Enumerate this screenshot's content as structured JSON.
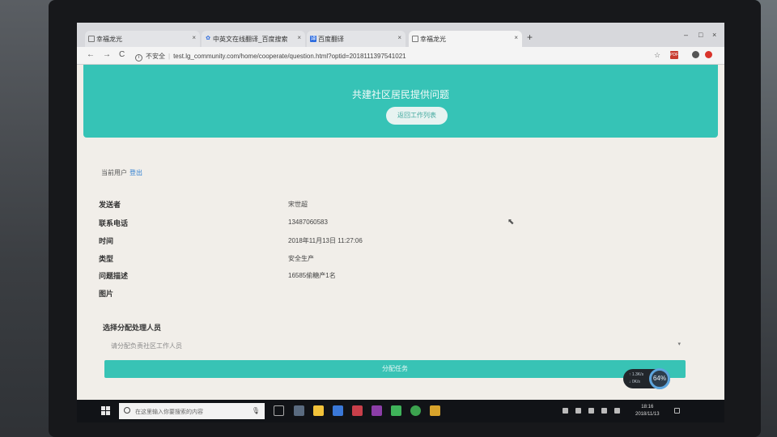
{
  "browser": {
    "tabs": [
      {
        "title": "幸福龙光",
        "close": "×"
      },
      {
        "title": "中英文在线翻译_百度搜索",
        "close": "×"
      },
      {
        "title": "百度翻译",
        "close": "×"
      },
      {
        "title": "幸福龙光",
        "close": "×"
      }
    ],
    "new_tab": "+",
    "window_controls": [
      "–",
      "□",
      "×"
    ],
    "nav": {
      "back": "←",
      "forward": "→",
      "reload": "C"
    },
    "address": {
      "security": "不安全",
      "url": "test.lg_community.com/home/cooperate/question.html?optid=20181113975410​21"
    }
  },
  "page": {
    "title": "共建社区居民提供问题",
    "back_button": "返回工作列表",
    "current_user_label": "当前用户",
    "logout": "登出",
    "details": [
      {
        "label": "发送者",
        "value": "宋世超"
      },
      {
        "label": "联系电话",
        "value": "13487060583"
      },
      {
        "label": "时间",
        "value": "2018年11月13日 11:27:06"
      },
      {
        "label": "类型",
        "value": "安全生产"
      },
      {
        "label": "问题描述",
        "value": "16585偷糖产1名"
      },
      {
        "label": "图片",
        "value": ""
      }
    ],
    "assign_label": "选择分配处理人员",
    "assign_placeholder": "请分配负责社区工作人员",
    "assign_button": "分配任务",
    "speed_widget": {
      "up": "↑ 1.3K/s",
      "down": "↓ 0K/s",
      "percent": "64%"
    }
  },
  "taskbar": {
    "search_placeholder": "在这里输入你要搜索的内容",
    "time": "18:16",
    "date": "2018/11/13",
    "app_colors": [
      "#5a6b80",
      "#f2c23a",
      "#3a78d8",
      "#c83f4a",
      "#8c3ea8",
      "#3fb35a",
      "#3ca34f",
      "#d8a32b",
      "#e0c64c"
    ]
  },
  "colors": {
    "banner": "#36c3b6",
    "assign_button": "#38c3b5",
    "page_bg": "#f1eee9"
  }
}
